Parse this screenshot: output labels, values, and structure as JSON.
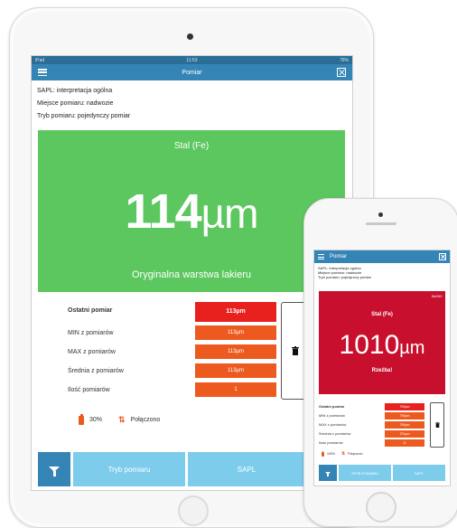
{
  "tablet": {
    "title": "Pomiar",
    "status": {
      "left": "iPad",
      "time": "11:53",
      "right": "76%"
    },
    "info": [
      "SAPL: interpretacja ogólna",
      "Miejsce pomiaru: nadwozie",
      "Tryb pomiaru: pojedynczy pomiar"
    ],
    "result": {
      "material": "Stal (Fe)",
      "value": "114",
      "unit": "µm",
      "description": "Oryginalna warstwa lakieru",
      "color": "#5cc75f"
    },
    "stats": [
      {
        "label": "Ostatni pomiar",
        "value": "113µm"
      },
      {
        "label": "MIN z pomiarów",
        "value": "113µm"
      },
      {
        "label": "MAX z pomiarów",
        "value": "113µm"
      },
      {
        "label": "Średnia z pomiarów",
        "value": "113µm"
      },
      {
        "label": "Ilość pomiarów",
        "value": "1"
      }
    ],
    "battery": "30%",
    "connection": "Połączono",
    "buttons": {
      "mode": "Tryb pomiaru",
      "sapl": "SAPL"
    }
  },
  "phone": {
    "title": "Pomiar",
    "info": [
      "SAPL: interpretacja ogólna",
      "Miejsce pomiaru: nadwozie",
      "Tryb pomiaru: pojedynczy pomiar"
    ],
    "result": {
      "badge": "BASIC",
      "material": "Stal (Fe)",
      "value": "1010",
      "unit": "µm",
      "description": "Rzeźba!",
      "color": "#c8102e"
    },
    "stats": [
      {
        "label": "Ostatni pomiar",
        "value": "790µm"
      },
      {
        "label": "MIN z pomiarów",
        "value": "790µm"
      },
      {
        "label": "MAX z pomiarów",
        "value": "790µm"
      },
      {
        "label": "Średnia z pomiarów",
        "value": "374µm"
      },
      {
        "label": "Ilość pomiarów",
        "value": "11"
      }
    ],
    "battery": "100%",
    "connection": "Połączono",
    "buttons": {
      "mode": "TRYB POMIARU",
      "sapl": "SAPL"
    }
  }
}
